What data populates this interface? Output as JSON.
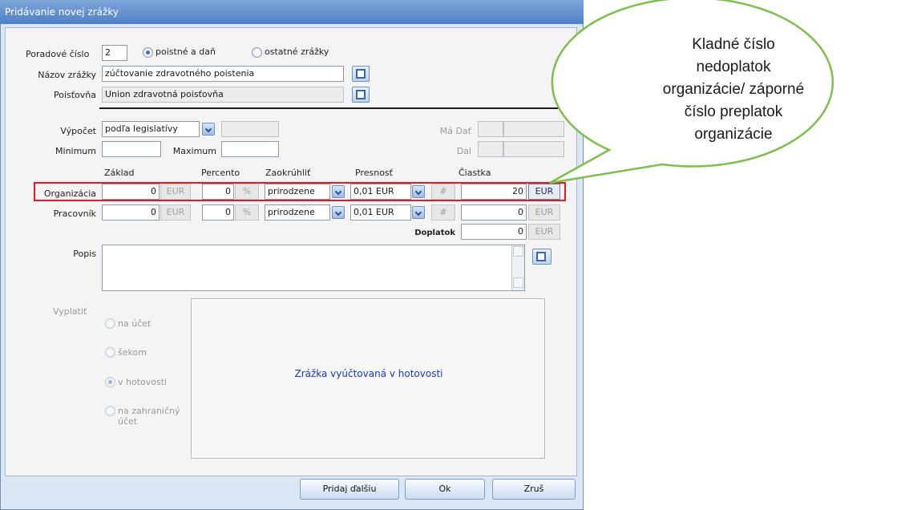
{
  "window": {
    "title": "Pridávanie novej zrážky"
  },
  "header": {
    "poradove_label": "Poradové číslo",
    "poradove_value": "2",
    "radio_poistne": "poistné a daň",
    "radio_ostatne": "ostatné zrážky",
    "nazov_label": "Názov zrážky",
    "nazov_value": "zúčtovanie zdravotného poistenia",
    "poistovna_label": "Poisťovňa",
    "poistovna_value": "Union zdravotná poisťovňa"
  },
  "calc": {
    "vypocet_label": "Výpočet",
    "vypocet_value": "podľa legislatívy",
    "minimum_label": "Minimum",
    "maximum_label": "Maximum",
    "madat_label": "Má Dať",
    "dal_label": "Dal"
  },
  "columns": {
    "zaklad": "Základ",
    "percento": "Percento",
    "zaokruhlit": "Zaokrúhliť",
    "presnost": "Presnosť",
    "ciastka": "Čiastka"
  },
  "rows": [
    {
      "label": "Organizácia",
      "zaklad": "0",
      "currency": "EUR",
      "percento": "0",
      "percent_unit": "%",
      "zaokruhlit": "prirodzene",
      "presnost": "0,01 EUR",
      "hash": "#",
      "ciastka": "20",
      "ciastka_unit": "EUR"
    },
    {
      "label": "Pracovník",
      "zaklad": "0",
      "currency": "EUR",
      "percento": "0",
      "percent_unit": "%",
      "zaokruhlit": "prirodzene",
      "presnost": "0,01 EUR",
      "hash": "#",
      "ciastka": "0",
      "ciastka_unit": "EUR"
    }
  ],
  "doplatok": {
    "label": "Doplatok",
    "value": "0",
    "unit": "EUR"
  },
  "popis": {
    "label": "Popis"
  },
  "vyplatit": {
    "label": "Vyplatiť",
    "options": [
      "na účet",
      "šekom",
      "v hotovosti",
      "na zahraničný účet"
    ],
    "selected": "v hotovosti",
    "panel_message": "Zrážka vyúčtovaná v hotovosti"
  },
  "buttons": {
    "pridaj": "Pridaj ďalšiu",
    "ok": "Ok",
    "zrus": "Zruš"
  },
  "callout": {
    "text_lines": [
      "Kladné číslo",
      "nedoplatok",
      "organizácie/ záporné",
      "číslo preplatok",
      "organizácie"
    ],
    "fill_color": "#ffffff",
    "border_color": "#7cbf4a"
  },
  "highlight_color": "#e41b23"
}
